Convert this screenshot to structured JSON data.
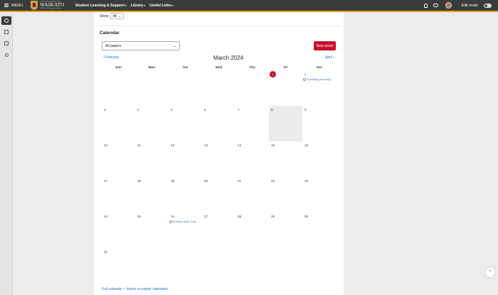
{
  "nav": {
    "menu_label": "MENU",
    "logo_small": "THE UNIVERSITY OF",
    "logo_main": "WAIKATO",
    "logo_motto": "Te Whare Wānanga o Waikato",
    "links": [
      {
        "label": "Student Learning & Support",
        "caret": "▾"
      },
      {
        "label": "Library",
        "caret": "▾"
      },
      {
        "label": "Useful Links",
        "caret": "▾"
      }
    ],
    "edit_mode_label": "Edit mode",
    "accent": "#e3a21a"
  },
  "rail": {
    "icons": [
      "dashboard-icon",
      "courses-icon",
      "library-icon",
      "search-icon"
    ]
  },
  "filter": {
    "show_label": "Show",
    "show_value": "All",
    "show_caret": "⌄"
  },
  "calendar": {
    "heading": "Calendar",
    "papers_value": "All papers",
    "papers_caret": "⌄",
    "new_event_label": "New event",
    "prev_label": "‹ February",
    "month_title": "March 2024",
    "next_label": "April ›",
    "weekdays": [
      "Sun",
      "Mon",
      "Tue",
      "Wed",
      "Thu",
      "Fri",
      "Sat"
    ],
    "weeks": [
      [
        {
          "d": ""
        },
        {
          "d": ""
        },
        {
          "d": ""
        },
        {
          "d": ""
        },
        {
          "d": ""
        },
        {
          "d": "1",
          "today": true
        },
        {
          "d": "2",
          "link": true,
          "event": "Submitting an assig..."
        }
      ],
      [
        {
          "d": "3"
        },
        {
          "d": "4"
        },
        {
          "d": "5"
        },
        {
          "d": "6"
        },
        {
          "d": "7"
        },
        {
          "d": "8",
          "shaded": true
        },
        {
          "d": "9"
        }
      ],
      [
        {
          "d": "10"
        },
        {
          "d": "11"
        },
        {
          "d": "12"
        },
        {
          "d": "13"
        },
        {
          "d": "14"
        },
        {
          "d": "15"
        },
        {
          "d": "16"
        }
      ],
      [
        {
          "d": "17"
        },
        {
          "d": "18"
        },
        {
          "d": "19"
        },
        {
          "d": "20"
        },
        {
          "d": "21"
        },
        {
          "d": "22"
        },
        {
          "d": "23"
        }
      ],
      [
        {
          "d": "24"
        },
        {
          "d": "25"
        },
        {
          "d": "26",
          "link": true,
          "event": "Emma's class Tues..."
        },
        {
          "d": "27"
        },
        {
          "d": "28"
        },
        {
          "d": "29"
        },
        {
          "d": "30"
        }
      ],
      [
        {
          "d": "31"
        },
        {
          "d": ""
        },
        {
          "d": ""
        },
        {
          "d": ""
        },
        {
          "d": ""
        },
        {
          "d": ""
        },
        {
          "d": ""
        }
      ]
    ],
    "brand_color": "#c8102e",
    "link_color": "#2a6ebb"
  },
  "footer": {
    "full_calendar": "Full calendar",
    "separator": "•",
    "import_export": "Import or export calendars"
  }
}
